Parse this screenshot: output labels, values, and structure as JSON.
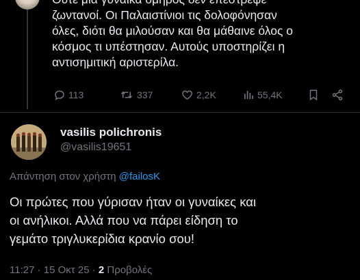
{
  "top_tweet": {
    "lines": [
      "Ούτε μια γυναίκα όμηρος δεν επέστρεψε",
      "ζωντανοί. Οι Παλαιστίνιοι τις δολοφόνησαν",
      "όλες, διότι θα μιλούσαν και θα μάθαινε όλος ο",
      "κόσμος τι υπέστησαν. Αυτούς υποστηρίζει η",
      "αντισημιτική αριστερίλα."
    ],
    "stats": {
      "replies": "113",
      "reposts": "337",
      "likes": "2,2K",
      "views": "55,4K"
    }
  },
  "reply_tweet": {
    "display_name": "vasilis polichronis",
    "handle": "@vasilis19651",
    "replying_prefix": "Απάντηση στον χρήστη",
    "replying_to": "@failosK",
    "lines": [
      "Οι πρώτες που γύρισαν ήταν οι γυναίκες και",
      "οι ανήλικοι. Αλλά που να πάρει είδηση το",
      "γεμάτο τριγλυκερίδια κρανίο σου!"
    ],
    "timestamp": "11:27 · 15 Οκτ 25 · ",
    "views_count": "2",
    "views_label": " Προβολές"
  },
  "colors": {
    "background": "#000000",
    "text_primary": "#e7e9ea",
    "text_secondary": "#71767b",
    "accent": "#1d9bf0",
    "divider": "#2f3336"
  },
  "icons": [
    "reply-icon",
    "repost-icon",
    "like-icon",
    "views-icon",
    "bookmark-icon",
    "share-icon"
  ]
}
